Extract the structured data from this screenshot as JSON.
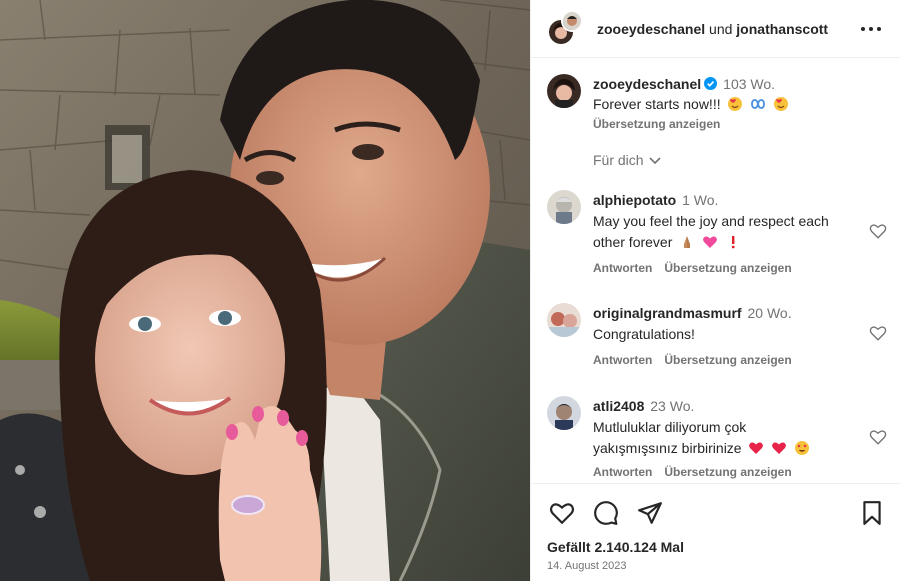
{
  "header": {
    "user1": "zooeydeschanel",
    "joiner": "und",
    "user2": "jonathanscott"
  },
  "caption": {
    "username": "zooeydeschanel",
    "time": "103 Wo.",
    "text": "Forever starts now!!!",
    "translate": "Übersetzung anzeigen",
    "emojis": [
      "heart-face-icon",
      "infinity-icon",
      "heart-face-icon"
    ]
  },
  "filter": {
    "label": "Für dich"
  },
  "comments": [
    {
      "username": "alphiepotato",
      "time": "1 Wo.",
      "text": "May you feel the joy and respect each other forever",
      "reply": "Antworten",
      "translate": "Übersetzung anzeigen",
      "emojis": [
        "praying-hands-icon",
        "pink-heart-icon",
        "exclamation-icon"
      ]
    },
    {
      "username": "originalgrandmasmurf",
      "time": "20 Wo.",
      "text": "Congratulations!",
      "reply": "Antworten",
      "translate": "Übersetzung anzeigen"
    },
    {
      "username": "atli2408",
      "time": "23 Wo.",
      "text_line1": "Mutluluklar diliyorum çok",
      "text_line2": "yakışmışsınız birbirinize",
      "reply": "Antworten",
      "translate": "Übersetzung anzeigen",
      "emojis": [
        "red-heart-icon",
        "red-heart-icon",
        "heart-eyes-icon"
      ]
    }
  ],
  "footer": {
    "likes": "Gefällt 2.140.124 Mal",
    "date": "14. August 2023"
  },
  "colors": {
    "text": "#262626",
    "secondary": "#737373",
    "verified": "#0095f6",
    "border": "#efefef"
  }
}
